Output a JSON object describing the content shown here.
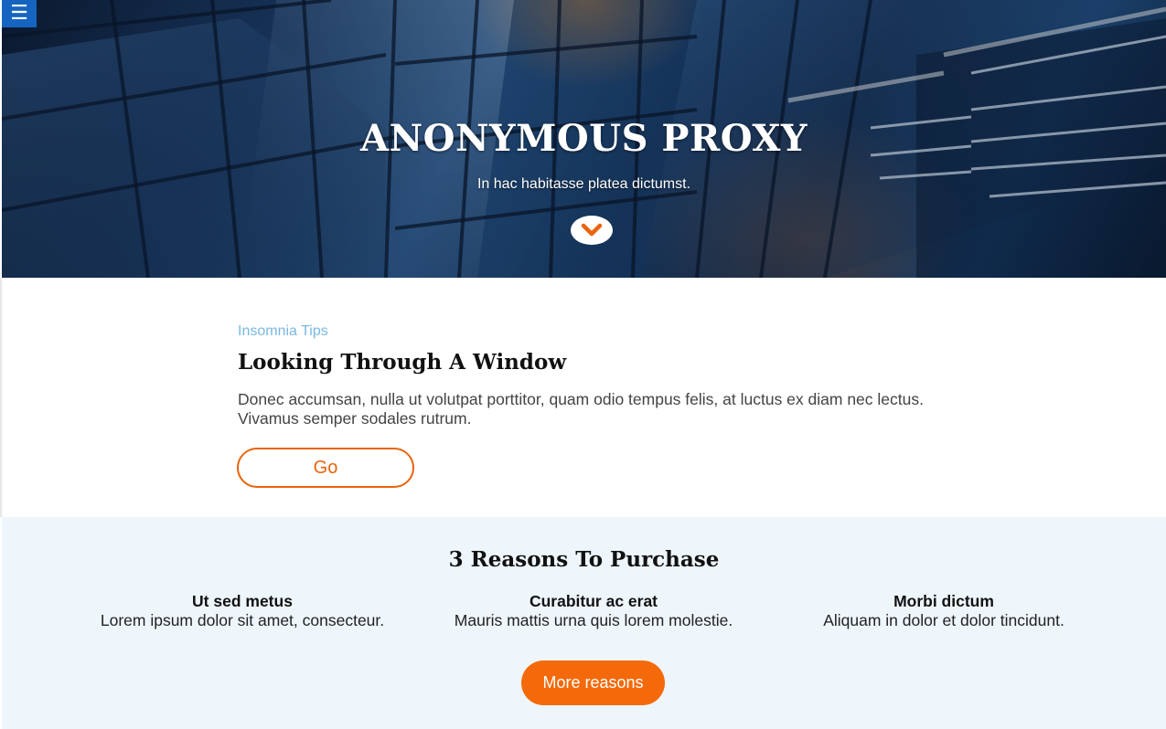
{
  "hero": {
    "title": "ANONYMOUS PROXY",
    "subtitle": "In hac habitasse platea dictumst."
  },
  "nav": {
    "menu_icon": "hamburger-icon",
    "menu_glyph": "☰"
  },
  "article": {
    "kicker": "Insomnia Tips",
    "title": "Looking Through A Window",
    "body": "Donec accumsan, nulla ut volutpat porttitor, quam odio tempus felis, at luctus ex diam nec lectus. Vivamus semper sodales rutrum.",
    "button_label": "Go"
  },
  "reasons": {
    "title": "3 Reasons To Purchase",
    "items": [
      {
        "title": "Ut sed metus",
        "text": "Lorem ipsum dolor sit amet, consecteur."
      },
      {
        "title": "Curabitur ac erat",
        "text": "Mauris mattis urna quis lorem molestie."
      },
      {
        "title": "Morbi dictum",
        "text": "Aliquam in dolor et dolor tincidunt."
      }
    ],
    "button_label": "More reasons"
  },
  "colors": {
    "accent": "#f46a0a",
    "menu": "#1565c0",
    "kicker": "#7ab8e0",
    "reasons_bg": "#eef6fc"
  }
}
